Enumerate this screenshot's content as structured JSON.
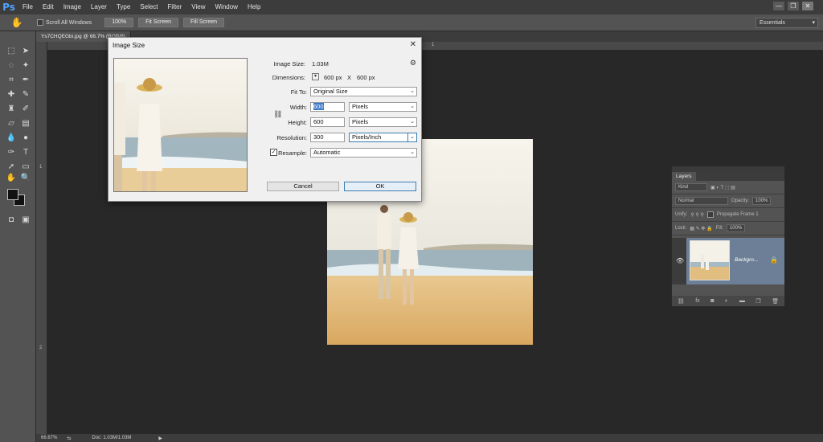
{
  "app": {
    "logo": "Ps"
  },
  "menu": [
    "File",
    "Edit",
    "Image",
    "Layer",
    "Type",
    "Select",
    "Filter",
    "View",
    "Window",
    "Help"
  ],
  "window_controls": {
    "minimize": "—",
    "restore": "❐",
    "close": "✕"
  },
  "options_bar": {
    "scroll_all_windows": "Scroll All Windows",
    "zoom_100": "100%",
    "fit_screen": "Fit Screen",
    "fill_screen": "Fill Screen",
    "workspace": "Essentials"
  },
  "doc_tabs": {
    "active": "Ys7CHQEGbi.jpg @ 66.7% (RGB/8)"
  },
  "rulers": {
    "top_labels": [
      "1"
    ],
    "left_labels": [
      "1",
      "2"
    ]
  },
  "status_bar": {
    "zoom": "66.67%",
    "doc": "Doc: 1.03M/1.03M"
  },
  "layers_panel": {
    "tab": "Layers",
    "filter": "Kind",
    "blend_mode": "Normal",
    "opacity_label": "Opacity:",
    "opacity_value": "100%",
    "unify_label": "Unify:",
    "propagate_frame": "Propagate Frame 1",
    "lock_label": "Lock:",
    "fill_label": "Fill:",
    "fill_value": "100%",
    "layer_name": "Backgro..."
  },
  "dialog": {
    "title": "Image Size",
    "image_size_label": "Image Size:",
    "image_size_value": "1.03M",
    "dimensions_label": "Dimensions:",
    "dim_w": "600 px",
    "dim_x": "X",
    "dim_h": "600 px",
    "fit_to_label": "Fit To:",
    "fit_to_value": "Original Size",
    "width_label": "Width:",
    "width_value": "600",
    "width_unit": "Pixels",
    "height_label": "Height:",
    "height_value": "600",
    "height_unit": "Pixels",
    "resolution_label": "Resolution:",
    "resolution_value": "300",
    "resolution_unit": "Pixels/Inch",
    "resample_label": "Resample:",
    "resample_value": "Automatic",
    "cancel": "Cancel",
    "ok": "OK"
  }
}
